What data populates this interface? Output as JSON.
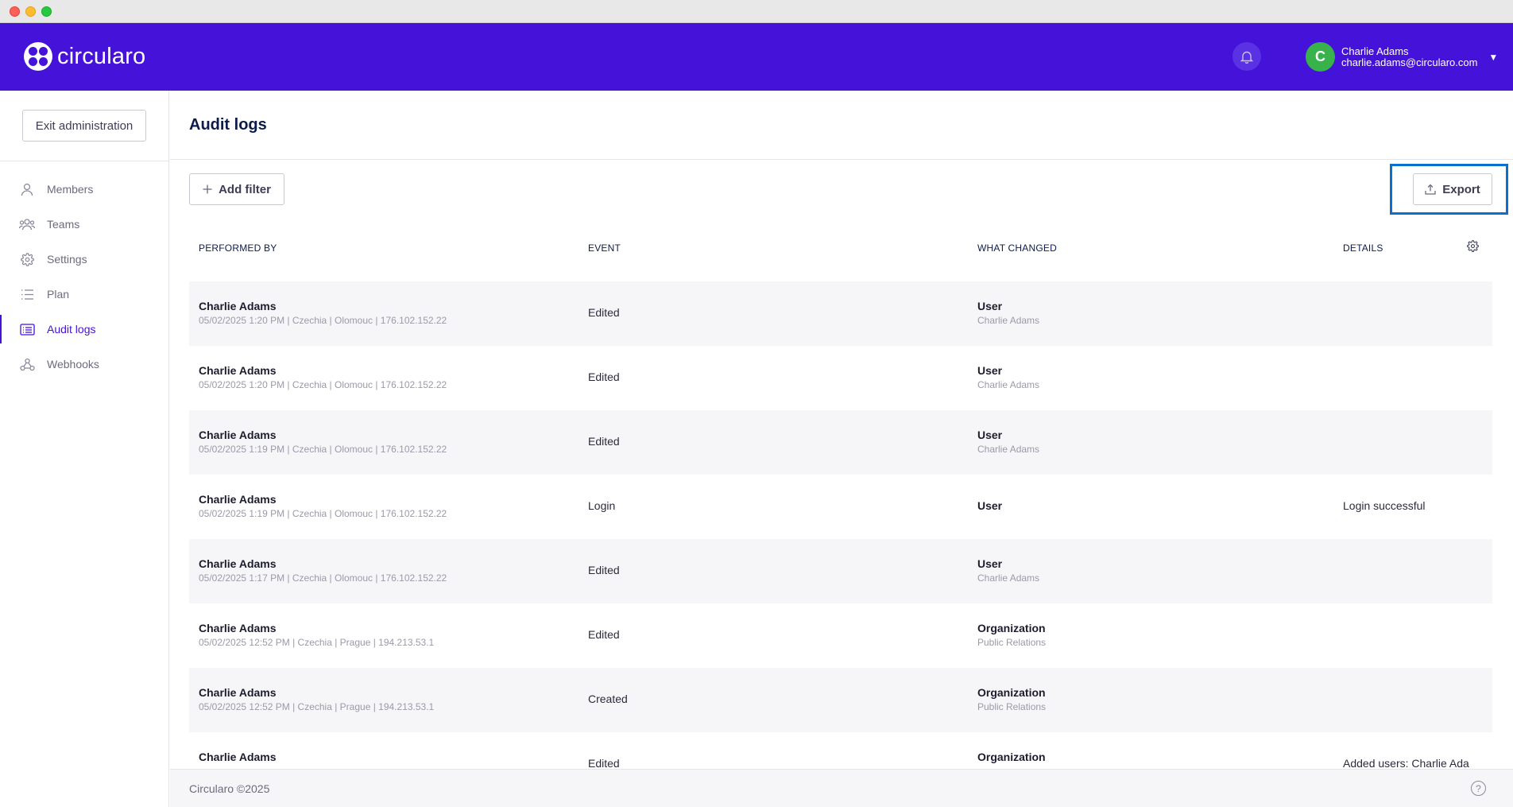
{
  "app": {
    "name": "circularo",
    "brand_color": "#4512da"
  },
  "header": {
    "user": {
      "initial": "C",
      "name": "Charlie Adams",
      "email": "charlie.adams@circularo.com"
    }
  },
  "sidebar": {
    "exit_label": "Exit administration",
    "items": [
      {
        "label": "Members",
        "icon": "user-icon"
      },
      {
        "label": "Teams",
        "icon": "team-icon"
      },
      {
        "label": "Settings",
        "icon": "gear-icon"
      },
      {
        "label": "Plan",
        "icon": "list-icon"
      },
      {
        "label": "Audit logs",
        "icon": "log-icon",
        "active": true
      },
      {
        "label": "Webhooks",
        "icon": "webhook-icon"
      }
    ]
  },
  "main": {
    "title": "Audit logs",
    "add_filter_label": "Add filter",
    "export_label": "Export",
    "columns": [
      "PERFORMED BY",
      "EVENT",
      "WHAT CHANGED",
      "DETAILS"
    ],
    "rows": [
      {
        "name": "Charlie Adams",
        "meta": "05/02/2025 1:20 PM  |  Czechia  |  Olomouc  |  176.102.152.22",
        "event": "Edited",
        "type": "User",
        "target": "Charlie Adams",
        "details": ""
      },
      {
        "name": "Charlie Adams",
        "meta": "05/02/2025 1:20 PM  |  Czechia  |  Olomouc  |  176.102.152.22",
        "event": "Edited",
        "type": "User",
        "target": "Charlie Adams",
        "details": ""
      },
      {
        "name": "Charlie Adams",
        "meta": "05/02/2025 1:19 PM  |  Czechia  |  Olomouc  |  176.102.152.22",
        "event": "Edited",
        "type": "User",
        "target": "Charlie Adams",
        "details": ""
      },
      {
        "name": "Charlie Adams",
        "meta": "05/02/2025 1:19 PM  |  Czechia  |  Olomouc  |  176.102.152.22",
        "event": "Login",
        "type": "User",
        "target": "",
        "details": "Login successful"
      },
      {
        "name": "Charlie Adams",
        "meta": "05/02/2025 1:17 PM  |  Czechia  |  Olomouc  |  176.102.152.22",
        "event": "Edited",
        "type": "User",
        "target": "Charlie Adams",
        "details": ""
      },
      {
        "name": "Charlie Adams",
        "meta": "05/02/2025 12:52 PM  |  Czechia  |  Prague  |  194.213.53.1",
        "event": "Edited",
        "type": "Organization",
        "target": "Public Relations",
        "details": ""
      },
      {
        "name": "Charlie Adams",
        "meta": "05/02/2025 12:52 PM  |  Czechia  |  Prague  |  194.213.53.1",
        "event": "Created",
        "type": "Organization",
        "target": "Public Relations",
        "details": ""
      },
      {
        "name": "Charlie Adams",
        "meta": "",
        "event": "Edited",
        "type": "Organization",
        "target": "",
        "details": "Added users: Charlie Ada"
      }
    ]
  },
  "footer": {
    "copyright": "Circularo ©2025"
  }
}
